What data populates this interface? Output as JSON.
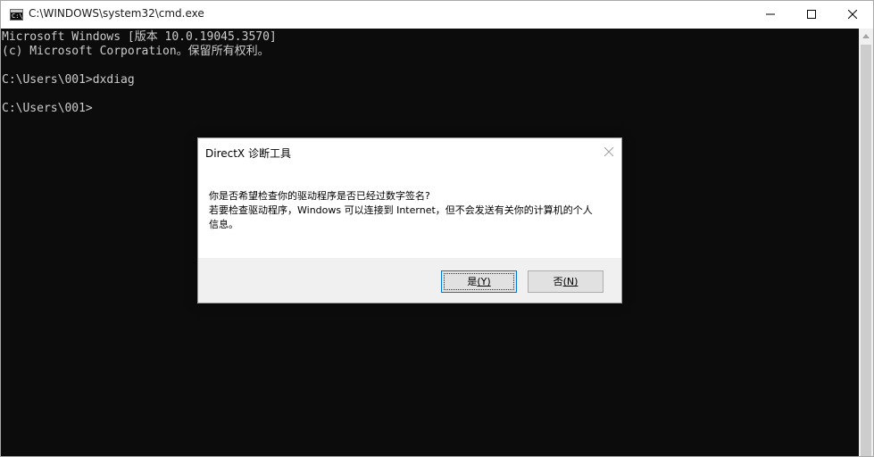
{
  "window": {
    "title": "C:\\WINDOWS\\system32\\cmd.exe",
    "icon": "cmd-app-icon",
    "icon_glyph": "C:\\"
  },
  "console": {
    "lines": [
      "Microsoft Windows [版本 10.0.19045.3570]",
      "(c) Microsoft Corporation。保留所有权利。",
      "",
      "C:\\Users\\001>dxdiag",
      "",
      "C:\\Users\\001>"
    ],
    "background": "#0c0c0c",
    "foreground": "#cccccc"
  },
  "dialog": {
    "title": "DirectX 诊断工具",
    "message": [
      "你是否希望检查你的驱动程序是否已经过数字签名?",
      "若要检查驱动程序，Windows 可以连接到 Internet，但不会发送有关你的计算机的个人",
      "信息。"
    ],
    "yes": {
      "label": "是",
      "mnemonic": "(Y)"
    },
    "no": {
      "label": "否",
      "mnemonic": "(N)"
    },
    "accent": "#0078d7"
  }
}
